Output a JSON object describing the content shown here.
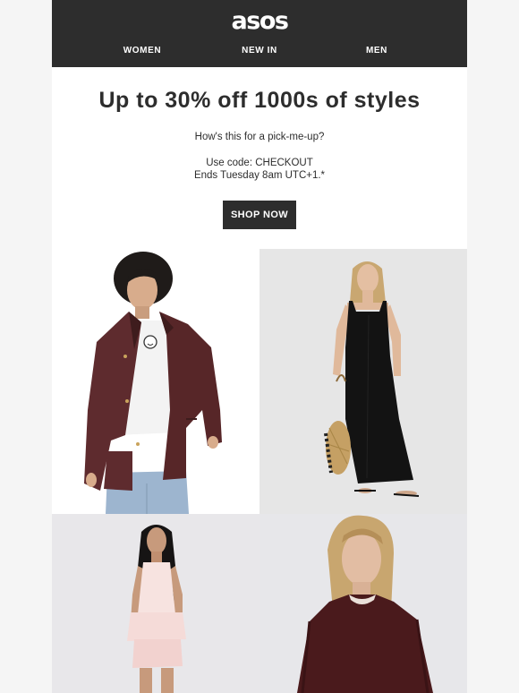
{
  "header": {
    "logo_text": "asos",
    "nav": [
      {
        "label": "WOMEN"
      },
      {
        "label": "NEW IN"
      },
      {
        "label": "MEN"
      }
    ]
  },
  "hero": {
    "headline": "Up to 30% off 1000s of styles",
    "subtext": "How's this for a pick-me-up?",
    "code_line": "Use code: CHECKOUT",
    "ends_line": "Ends Tuesday 8am UTC+1.*",
    "cta_label": "SHOP NOW"
  },
  "colors": {
    "header_bg": "#2d2d2d",
    "button_bg": "#2d2d2d",
    "page_bg": "#f5f5f5",
    "text": "#2d2d2d"
  },
  "products": [
    {
      "image": "model-burgundy-jacket-photo"
    },
    {
      "image": "model-black-maxi-dress-photo"
    },
    {
      "image": "model-pink-peplum-top-photo"
    },
    {
      "image": "model-burgundy-knit-jumper-photo"
    }
  ]
}
